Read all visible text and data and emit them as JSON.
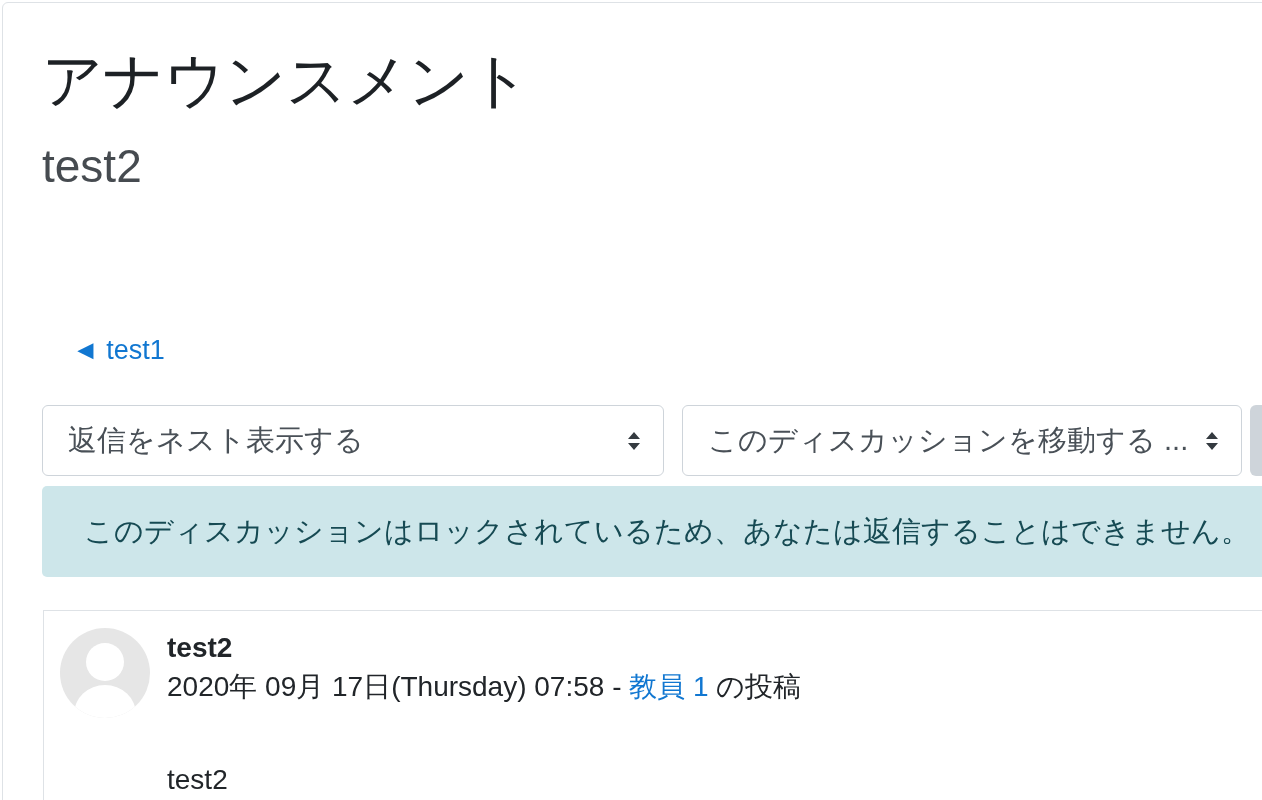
{
  "page_header": {
    "title": "アナウンスメント",
    "subtitle": "test2"
  },
  "navigation": {
    "previous_link": "◄ test1"
  },
  "controls": [
    {
      "kind": "select",
      "value": "返信をネスト表示する"
    },
    {
      "kind": "select",
      "value": "このディスカッションを移動する ..."
    },
    {
      "kind": "button"
    }
  ],
  "alert": {
    "message": "このディスカッションはロックされているため、あなたは返信することはできません。"
  },
  "post": {
    "subject": "test2",
    "byline": {
      "posted": "2020年 09月 17日(Thursday) 07:58 -",
      "author": "教員 1",
      "suffix": "の投稿"
    },
    "body": "test2"
  }
}
